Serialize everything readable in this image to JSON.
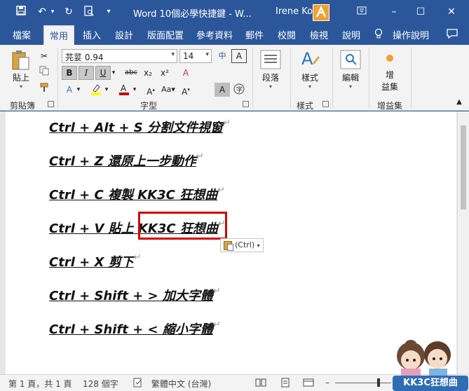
{
  "titlebar": {
    "title": "Word 10個必學快捷鍵 - W...",
    "user": "Irene Ko",
    "icons": [
      "save-icon",
      "undo-icon",
      "redo-icon",
      "print-preview-icon",
      "customize-icon"
    ],
    "window_buttons": [
      "ribbon-display-icon",
      "minimize-icon",
      "maximize-icon",
      "close-icon"
    ]
  },
  "tabs": [
    "檔案",
    "常用",
    "插入",
    "設計",
    "版面配置",
    "參考資料",
    "郵件",
    "校閱",
    "檢視",
    "說明",
    "操作說明"
  ],
  "active_tab": "常用",
  "ribbon": {
    "clipboard": {
      "paste_label": "貼上",
      "group_label": "剪貼簿"
    },
    "font": {
      "font_name": "芫荽 0.94",
      "font_size": "14",
      "buttons": [
        "B",
        "I",
        "U",
        "abc",
        "x₂",
        "x²"
      ],
      "group_label": "字型",
      "colors": {
        "highlight": "#ffff00",
        "font": "#c00000"
      }
    },
    "paragraph": {
      "label": "段落"
    },
    "styles": {
      "label": "樣式",
      "group_label": "樣式"
    },
    "editing": {
      "label": "編輯"
    },
    "addins": {
      "label_line1": "增",
      "label_line2": "益集",
      "group_label": "增益集"
    }
  },
  "document": {
    "lines": [
      "Ctrl + Alt + S  分割文件視窗",
      "Ctrl + Z  還原上一步動作 ",
      "Ctrl + C  複製   KK3C 狂想曲",
      "Ctrl + V  貼上   KK3C 狂想曲",
      "Ctrl + X  剪下",
      "Ctrl + Shift + >  加大字體",
      "Ctrl + Shift + <  縮小字體"
    ],
    "paste_options": "(Ctrl)",
    "highlight_color": "#d40000"
  },
  "status": {
    "page": "第 1 頁，共 1 頁",
    "words": "128 個字",
    "language": "繁體中文 (台灣)"
  },
  "watermark": "KK3C狂想曲"
}
